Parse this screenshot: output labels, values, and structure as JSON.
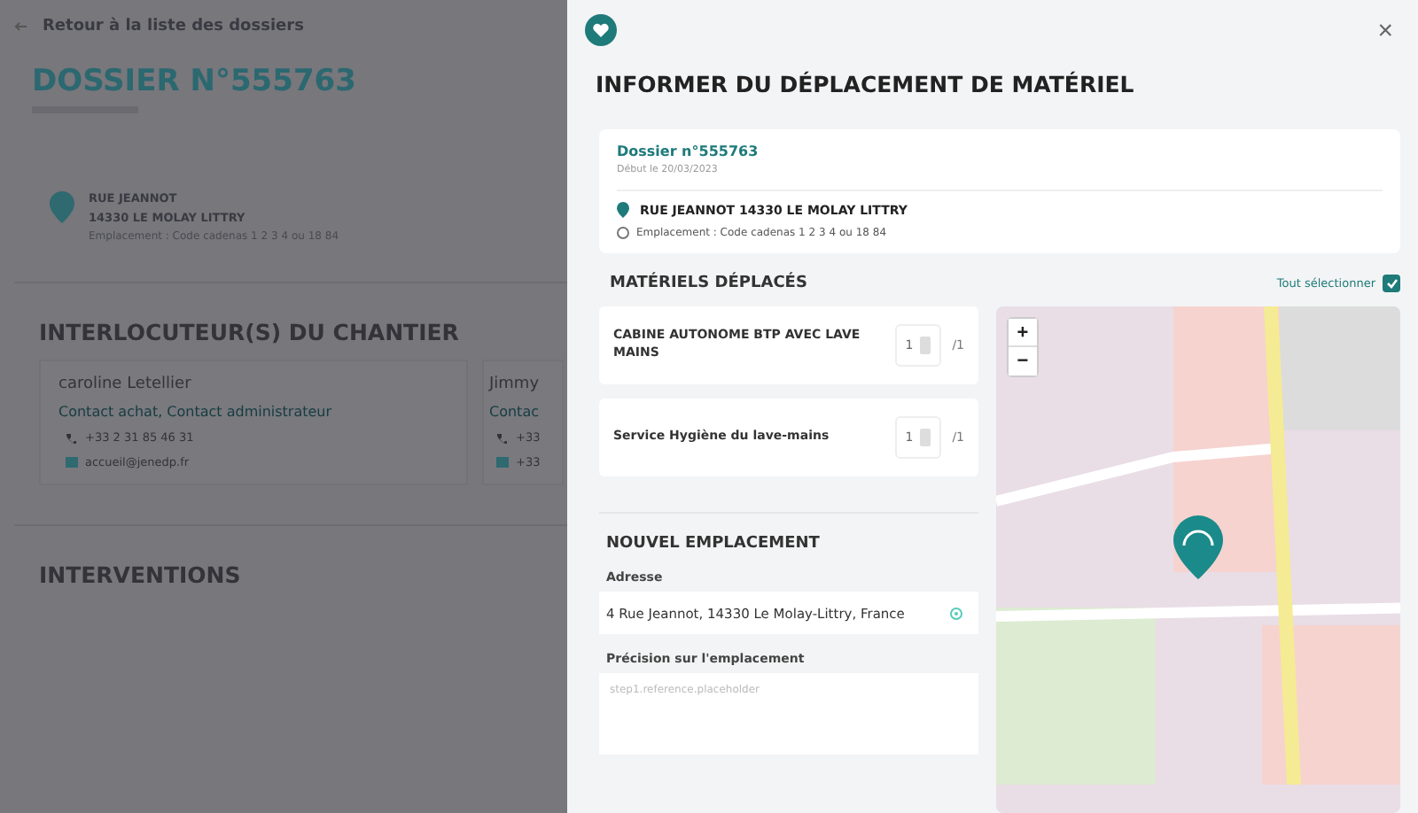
{
  "background_page": {
    "back_link": "Retour à la liste des dossiers",
    "title": "DOSSIER N°555763",
    "address_line_1": "RUE JEANNOT",
    "address_line_2": "14330 LE MOLAY LITTRY",
    "location_note": "Emplacement : Code cadenas 1 2 3 4 ou 18 84",
    "contacts_heading": "INTERLOCUTEUR(S) DU CHANTIER",
    "contacts": [
      {
        "name": "caroline Letellier",
        "roles": "Contact achat, Contact administrateur",
        "phone": "+33 2 31 85 46 31",
        "email": "accueil@jenedp.fr"
      },
      {
        "name": "Jimmy",
        "roles": "Contac",
        "phone": "+33",
        "email": "+33"
      }
    ],
    "interventions_heading": "INTERVENTIONS"
  },
  "modal": {
    "title": "INFORMER DU DÉPLACEMENT DE MATÉRIEL",
    "close": "×",
    "dossier": {
      "title": "Dossier n°555763",
      "start": "Début le 20/03/2023",
      "address": "RUE JEANNOT 14330 LE MOLAY LITTRY",
      "location_note": "Emplacement : Code cadenas 1 2 3 4 ou 18 84"
    },
    "materials_heading": "MATÉRIELS DÉPLACÉS",
    "select_all": {
      "label": "Tout sélectionner",
      "checked": true
    },
    "materials": [
      {
        "name": "CABINE AUTONOME BTP AVEC LAVE MAINS",
        "quantity": "1",
        "total": "/1"
      },
      {
        "name": "Service Hygiène du lave-mains",
        "quantity": "1",
        "total": "/1"
      }
    ],
    "new_location_heading": "NOUVEL EMPLACEMENT",
    "address_label": "Adresse",
    "address_value": "4 Rue Jeannot, 14330 Le Molay-Littry, France",
    "precision_label": "Précision sur l'emplacement",
    "precision_placeholder": "step1.reference.placeholder",
    "map": {
      "zoom_in": "+",
      "zoom_out": "−"
    }
  }
}
